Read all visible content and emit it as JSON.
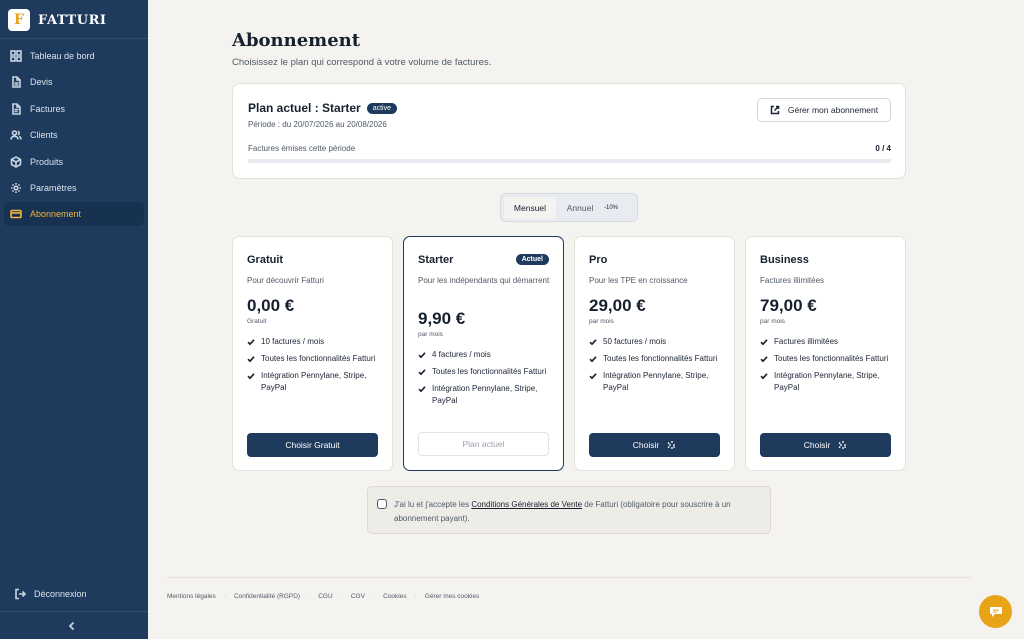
{
  "app": {
    "logo_letter": "F",
    "name": "FATTURI"
  },
  "sidebar": {
    "items": [
      {
        "label": "Tableau de bord",
        "icon": "dashboard-icon"
      },
      {
        "label": "Devis",
        "icon": "document-icon"
      },
      {
        "label": "Factures",
        "icon": "invoice-icon"
      },
      {
        "label": "Clients",
        "icon": "users-icon"
      },
      {
        "label": "Produits",
        "icon": "package-icon"
      },
      {
        "label": "Paramètres",
        "icon": "gear-icon"
      },
      {
        "label": "Abonnement",
        "icon": "credit-card-icon",
        "active": true
      }
    ],
    "logout_label": "Déconnexion"
  },
  "page": {
    "title": "Abonnement",
    "subtitle": "Choisissez le plan qui correspond à votre volume de factures."
  },
  "current_plan": {
    "title": "Plan actuel : Starter",
    "status_badge": "active",
    "period": "Période : du 20/07/2026 au 20/08/2026",
    "manage_label": "Gérer mon abonnement",
    "usage_label": "Factures émises cette période",
    "usage_count": "0 / 4",
    "usage_fraction": 0
  },
  "billing_toggle": {
    "monthly_label": "Mensuel",
    "annual_label": "Annuel",
    "annual_discount": "-10%",
    "selected": "monthly"
  },
  "plans": [
    {
      "name": "Gratuit",
      "desc": "Pour découvrir Fatturi",
      "price": "0,00 €",
      "per": "Gratuit",
      "features": [
        "10 factures / mois",
        "Toutes les fonctionnalités Fatturi",
        "Intégration Pennylane, Stripe, PayPal"
      ],
      "button": "Choisir Gratuit"
    },
    {
      "name": "Starter",
      "badge": "Actuel",
      "desc": "Pour les indépendants qui démarrent",
      "price": "9,90 €",
      "per": "par mois",
      "features": [
        "4 factures / mois",
        "Toutes les fonctionnalités Fatturi",
        "Intégration Pennylane, Stripe, PayPal"
      ],
      "button": "Plan actuel",
      "current": true
    },
    {
      "name": "Pro",
      "desc": "Pour les TPE en croissance",
      "price": "29,00 €",
      "per": "par mois",
      "features": [
        "50 factures / mois",
        "Toutes les fonctionnalités Fatturi",
        "Intégration Pennylane, Stripe, PayPal"
      ],
      "button": "Choisir"
    },
    {
      "name": "Business",
      "desc": "Factures illimitées",
      "price": "79,00 €",
      "per": "par mois",
      "features": [
        "Factures illimitées",
        "Toutes les fonctionnalités Fatturi",
        "Intégration Pennylane, Stripe, PayPal"
      ],
      "button": "Choisir"
    }
  ],
  "cgv": {
    "text_before": "J'ai lu et j'accepte les ",
    "link": "Conditions Générales de Vente",
    "text_after": " de Fatturi (obligatoire pour souscrire à un abonnement payant)."
  },
  "footer": {
    "links": [
      "Mentions légales",
      "Confidentialité (RGPD)",
      "CGU",
      "CGV",
      "Cookies",
      "Gérer mes cookies"
    ],
    "separator": "·"
  },
  "colors": {
    "sidebar": "#1e3a5c",
    "accent": "#f0b43c",
    "primary_button": "#1e3a5c",
    "chat_button": "#e8a317"
  }
}
